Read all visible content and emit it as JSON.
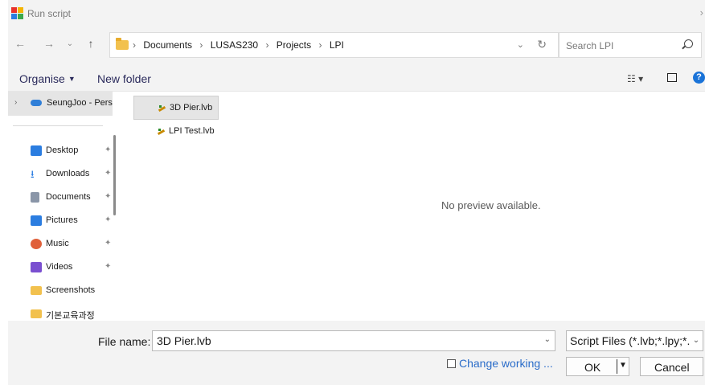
{
  "window": {
    "title": "Run script"
  },
  "nav": {
    "breadcrumbs": [
      "Documents",
      "LUSAS230",
      "Projects",
      "LPI"
    ],
    "search_placeholder": "Search LPI"
  },
  "toolbar": {
    "organise_label": "Organise",
    "new_folder_label": "New folder"
  },
  "sidebar": {
    "top_item": "SeungJoo - Pers",
    "items": [
      {
        "label": "Desktop",
        "icon": "desktop-icon",
        "color": "#2b7de0",
        "pinned": true
      },
      {
        "label": "Downloads",
        "icon": "download-icon",
        "color": "#2b7de0",
        "pinned": true
      },
      {
        "label": "Documents",
        "icon": "document-icon",
        "color": "#7a8aa0",
        "pinned": true
      },
      {
        "label": "Pictures",
        "icon": "picture-icon",
        "color": "#2b7de0",
        "pinned": true
      },
      {
        "label": "Music",
        "icon": "music-icon",
        "color": "#e0603a",
        "pinned": true
      },
      {
        "label": "Videos",
        "icon": "video-icon",
        "color": "#7a4fd0",
        "pinned": true
      },
      {
        "label": "Screenshots",
        "icon": "folder-icon",
        "color": "#f2c14e",
        "pinned": false
      },
      {
        "label": "기본교육과정",
        "icon": "folder-icon",
        "color": "#f2c14e",
        "pinned": false
      }
    ]
  },
  "files": [
    {
      "name": "3D Pier.lvb",
      "selected": true
    },
    {
      "name": "LPI Test.lvb",
      "selected": false
    }
  ],
  "preview_text": "No preview available.",
  "bottom": {
    "file_name_label": "File name:",
    "file_name_value": "3D Pier.lvb",
    "filter_value": "Script Files (*.lvb;*.lpy;*.",
    "change_working_label": "Change working ...",
    "ok_label": "OK",
    "cancel_label": "Cancel"
  }
}
